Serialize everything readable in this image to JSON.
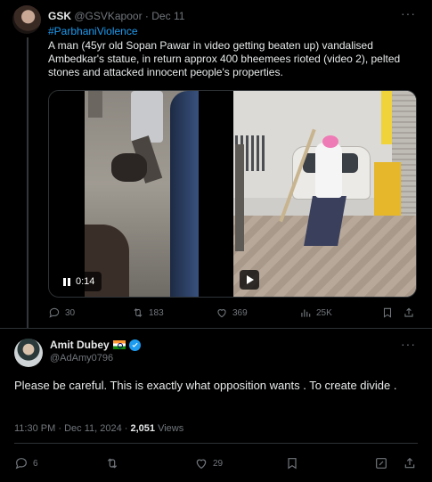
{
  "quoted_tweet": {
    "author_name": "GSK",
    "author_handle": "@GSVKapoor",
    "separator": "·",
    "date": "Dec 11",
    "hashtag": "#ParbhaniViolence",
    "text": "A man (45yr old Sopan Pawar in video getting beaten up) vandalised Ambedkar's statue, in return approx 400 bheemees rioted (video 2), pelted stones and attacked innocent people's properties.",
    "video_time": "0:14",
    "replies": "30",
    "reposts": "183",
    "likes": "369",
    "views": "25K",
    "more_label": "···"
  },
  "reply_tweet": {
    "author_name": "Amit Dubey",
    "author_handle": "@AdAmy0796",
    "text": "Please be careful. This is exactly what opposition wants . To create divide .",
    "time": "11:30 PM",
    "separator": "·",
    "date": "Dec 11, 2024",
    "views_count": "2,051",
    "views_label": "Views",
    "replies": "6",
    "likes": "29",
    "more_label": "···"
  },
  "colors": {
    "background": "#000000",
    "accent": "#1d9bf0",
    "muted": "#71767b",
    "text": "#e7e9ea",
    "border": "#2f3336"
  }
}
